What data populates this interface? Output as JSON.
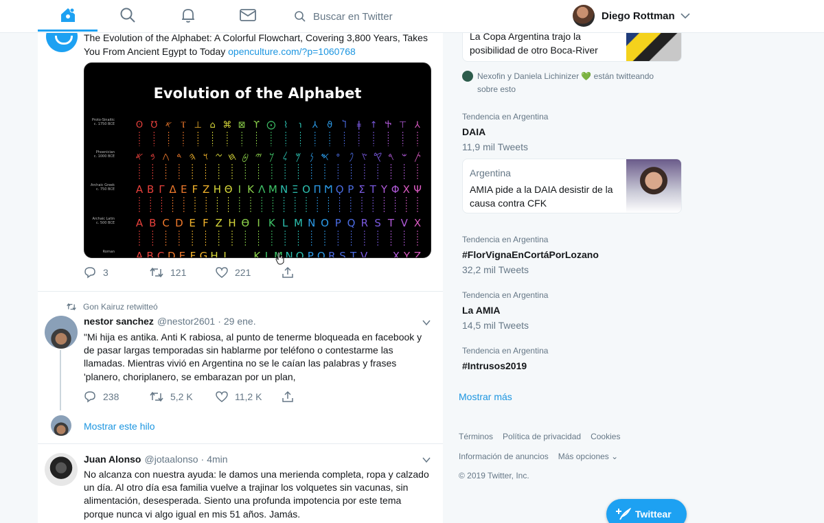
{
  "nav": {
    "search_placeholder": "Buscar en Twitter",
    "user_name": "Diego Rottman",
    "accent": "#1da1f2"
  },
  "tweet1": {
    "text": "The Evolution of the Alphabet: A Colorful Flowchart, Covering 3,800 Years, Takes You From Ancient Egypt to Today",
    "link": "openculture.com/?p=1060768",
    "media": {
      "title": "Evolution of the Alphabet",
      "rows": [
        {
          "label1": "Proto-Sinaitic",
          "label2": "c. 1750 BCE",
          "glyphs": "ʘ ℧ 𐤀 Ⲧ ⊥ ⌂ ⌘ ⊠ ϒ ⨀ ⌇ ℩ ⅄ ϑ Ⴈ ǂ ↑ Ⴕ ⊤ ⅄"
        },
        {
          "label1": "Phoenician",
          "label2": "c. 1000 BCE",
          "glyphs": "𐤀 𐤁 𐤂 𐤃 𐤄 𐤅 𐤆 𐤇 𐤈 𐤉 𐤊 𐤋 𐤌 𐤍 𐤎 𐤏 𐤐 𐤑 𐤒 𐤓 𐤔 𐤕"
        },
        {
          "label1": "Archaic Greek",
          "label2": "c. 750 BCE",
          "glyphs": "Α Β Γ Δ Ε Ϝ Ζ Η Θ Ι Κ Λ Μ Ν Ξ Ο Π Ϻ Ϙ Ρ Σ Τ Υ Φ Χ Ψ"
        },
        {
          "label1": "Archaic Latin",
          "label2": "c. 500 BCE",
          "glyphs": "A B C D E F Z H ϴ I K L M N O P Q R S T V X"
        },
        {
          "label1": "Roman",
          "label2": "",
          "glyphs": "A B C D E F G H I   K L M N O P Q R S T V   X Y Z"
        }
      ]
    },
    "actions": {
      "reply": "3",
      "retweet": "121",
      "like": "221"
    }
  },
  "retweet_context": "Gon Kairuz retwitteó",
  "tweet2": {
    "name": "nestor sanchez",
    "handle": "@nestor2601",
    "time": "29 ene.",
    "body": "\"Mi hija es antika. Anti K rabiosa, al punto de tenerme bloqueada en facebook y de pasar largas temporadas sin hablarme por teléfono o contestarme las llamadas. Mientras vivió en Argentina no se le caían las palabras y frases 'planero, choriplanero, se embarazan por un plan,",
    "actions": {
      "reply": "238",
      "retweet": "5,2 K",
      "like": "11,2 K"
    },
    "show_thread": "Mostrar este hilo"
  },
  "tweet3": {
    "name": "Juan Alonso",
    "handle": "@jotaalonso",
    "time": "4min",
    "body": "No alcanza con nuestra ayuda: le damos una merienda completa, ropa y calzado un día. Al otro día esa familia vuelve a trajinar los volquetes sin vacunas, sin alimentación, desesperada. Siento una profunda impotencia por este tema porque nunca vi algo igual en mis 51 años. Jamás."
  },
  "sidebar": {
    "card1_text": "La Copa Argentina trajo la posibilidad de otro Boca-River",
    "tweeting": "Nexofin y Daniela Lichinizer 💚 están twitteando sobre esto",
    "trend1": {
      "ctx": "Tendencia en Argentina",
      "name": "DAIA",
      "count": "11,9 mil Tweets"
    },
    "card2": {
      "cat": "Argentina",
      "text": "AMIA pide a la DAIA desistir de la causa contra CFK"
    },
    "trend2": {
      "ctx": "Tendencia en Argentina",
      "name": "#FlorVignaEnCortáPorLozano",
      "count": "32,2 mil Tweets"
    },
    "trend3": {
      "ctx": "Tendencia en Argentina",
      "name": "La AMIA",
      "count": "14,5 mil Tweets"
    },
    "trend4": {
      "ctx": "Tendencia en Argentina",
      "name": "#Intrusos2019"
    },
    "show_more": "Mostrar más",
    "footer": {
      "terms": "Términos",
      "privacy": "Política de privacidad",
      "cookies": "Cookies",
      "ads": "Información de anuncios",
      "more": "Más opciones",
      "copyright": "© 2019 Twitter, Inc."
    },
    "tweet_button": "Twittear"
  }
}
